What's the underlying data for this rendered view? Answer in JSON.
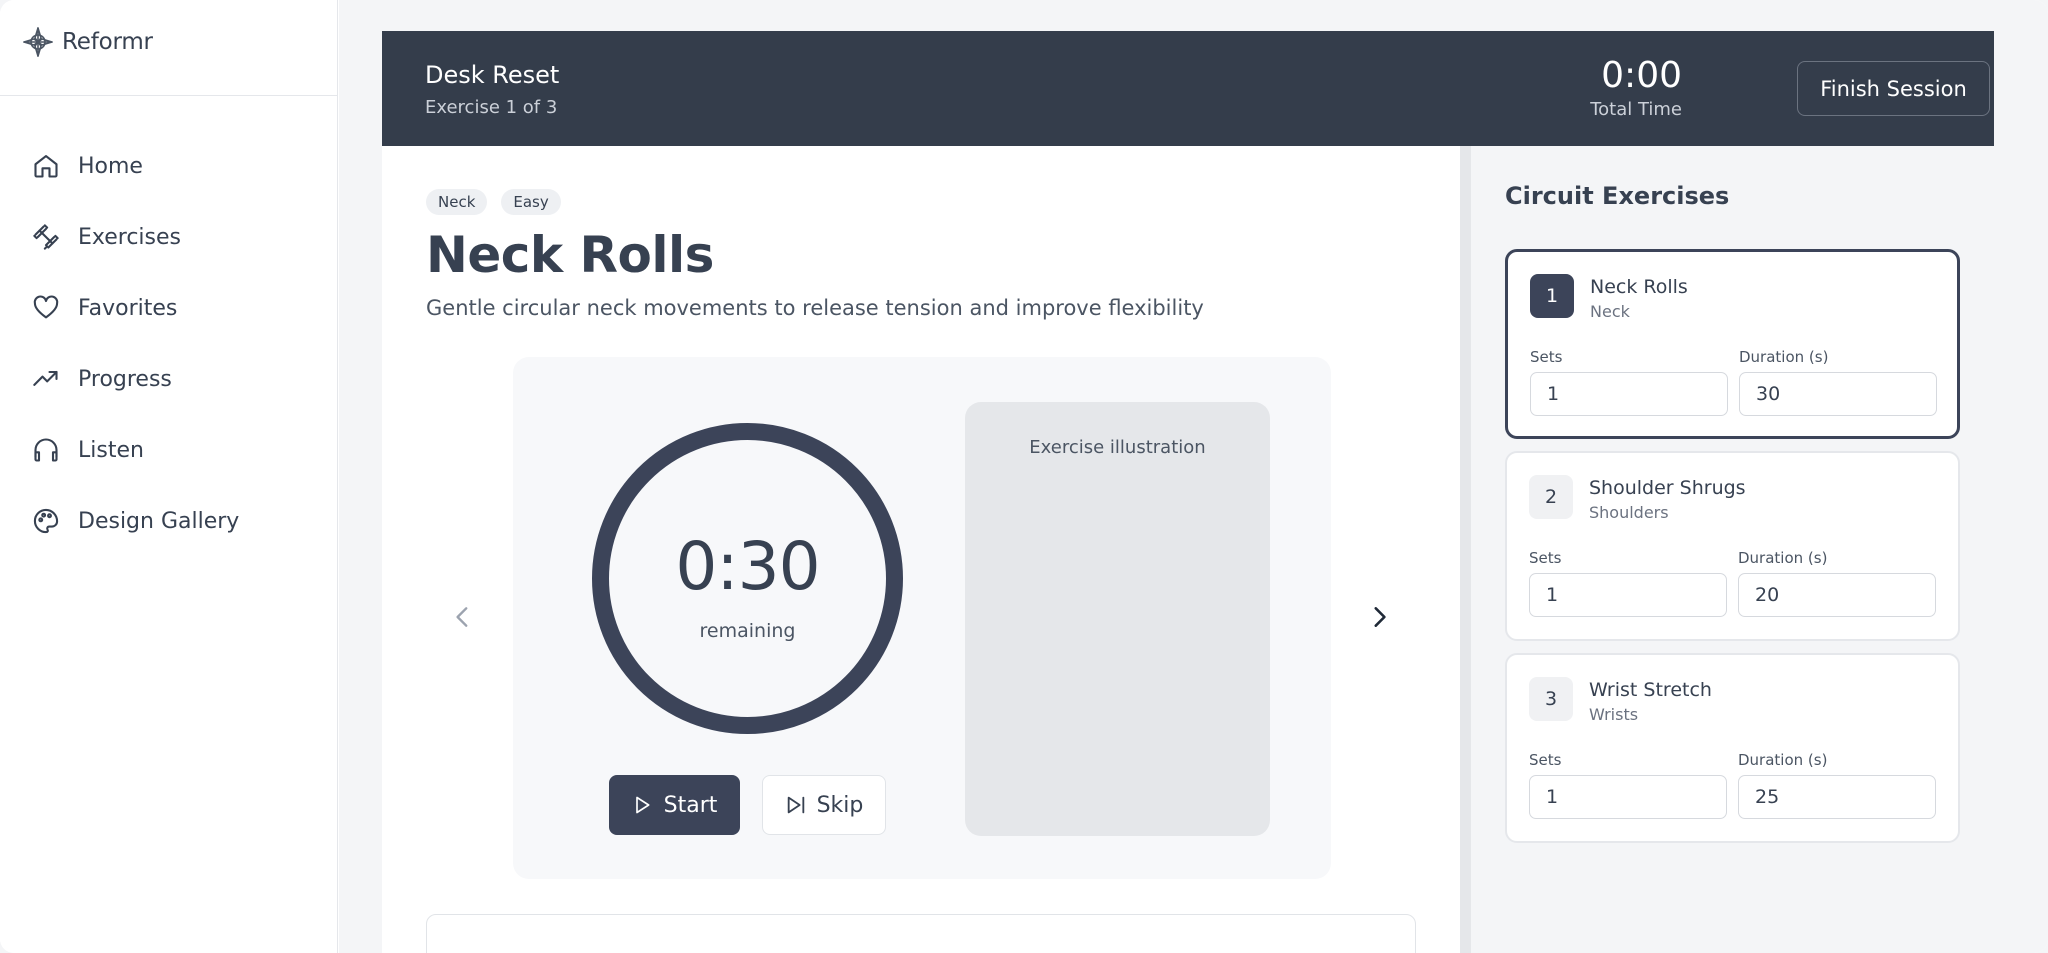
{
  "brand": {
    "name": "Reformr"
  },
  "nav": [
    {
      "label": "Home",
      "icon": "home-icon"
    },
    {
      "label": "Exercises",
      "icon": "dumbbell-icon"
    },
    {
      "label": "Favorites",
      "icon": "heart-icon"
    },
    {
      "label": "Progress",
      "icon": "trending-up-icon"
    },
    {
      "label": "Listen",
      "icon": "headphones-icon"
    },
    {
      "label": "Design Gallery",
      "icon": "palette-icon"
    }
  ],
  "session": {
    "title": "Desk Reset",
    "subtitle": "Exercise 1 of 3",
    "total_time": "0:00",
    "total_time_label": "Total Time",
    "finish_label": "Finish Session"
  },
  "exercise": {
    "tags": [
      "Neck",
      "Easy"
    ],
    "title": "Neck Rolls",
    "description": "Gentle circular neck movements to release tension and improve flexibility",
    "timer_value": "0:30",
    "timer_label": "remaining",
    "start_label": "Start",
    "skip_label": "Skip",
    "illustration_label": "Exercise illustration"
  },
  "circuit": {
    "title": "Circuit Exercises",
    "sets_label": "Sets",
    "duration_label": "Duration (s)",
    "items": [
      {
        "num": "1",
        "name": "Neck Rolls",
        "area": "Neck",
        "sets": "1",
        "duration": "30",
        "active": true
      },
      {
        "num": "2",
        "name": "Shoulder Shrugs",
        "area": "Shoulders",
        "sets": "1",
        "duration": "20",
        "active": false
      },
      {
        "num": "3",
        "name": "Wrist Stretch",
        "area": "Wrists",
        "sets": "1",
        "duration": "25",
        "active": false
      }
    ]
  },
  "colors": {
    "header_bg": "#343d4b",
    "accent": "#3c4459",
    "illustration_bg": "#e5e7ea"
  }
}
